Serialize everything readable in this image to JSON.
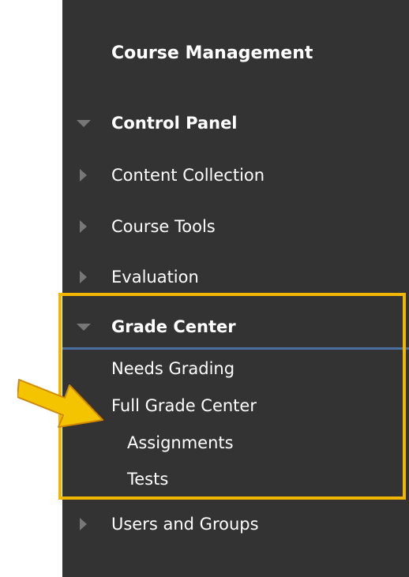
{
  "panel": {
    "title": "Course Management",
    "control_panel": "Control Panel",
    "items": [
      {
        "label": "Content Collection"
      },
      {
        "label": "Course Tools"
      },
      {
        "label": "Evaluation"
      }
    ],
    "grade_center": {
      "label": "Grade Center",
      "sub_items": [
        {
          "label": "Needs Grading"
        },
        {
          "label": "Full Grade Center"
        },
        {
          "label": "Assignments"
        },
        {
          "label": "Tests"
        }
      ]
    },
    "users_and_groups": "Users and Groups"
  },
  "colors": {
    "panel_bg": "#333333",
    "highlight": "#f2b600",
    "separator": "#4a6fa0",
    "arrow_fill": "#f5c400"
  }
}
